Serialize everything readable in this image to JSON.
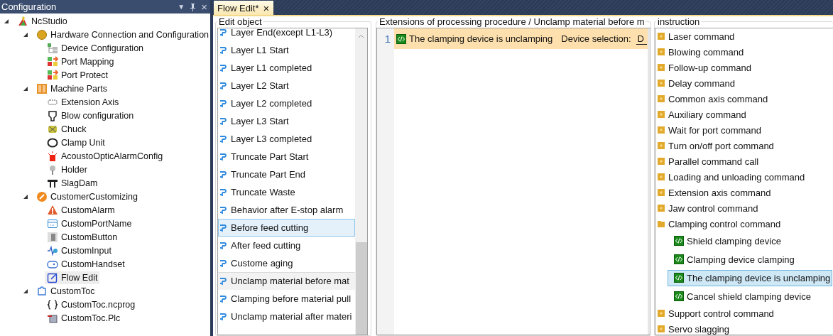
{
  "config_panel": {
    "title": "Configuration",
    "menu_glyph": "▼",
    "close_glyph": "×",
    "tree": [
      {
        "label": "NcStudio",
        "expanded": true,
        "selected": false,
        "children": [
          {
            "label": "Hardware Connection and Configuration",
            "expanded": true,
            "selected": false,
            "children": [
              {
                "label": "Device Configuration",
                "selected": false
              },
              {
                "label": "Port Mapping",
                "selected": false
              },
              {
                "label": "Port Protect",
                "selected": false
              }
            ]
          },
          {
            "label": "Machine Parts",
            "expanded": true,
            "selected": false,
            "children": [
              {
                "label": "Extension Axis",
                "selected": false
              },
              {
                "label": "Blow configuration",
                "selected": false
              },
              {
                "label": "Chuck",
                "selected": false
              },
              {
                "label": "Clamp Unit",
                "selected": false
              },
              {
                "label": "AcoustoOpticAlarmConfig",
                "selected": false
              },
              {
                "label": "Holder",
                "selected": false
              },
              {
                "label": "SlagDam",
                "selected": false
              }
            ]
          },
          {
            "label": "CustomerCustomizing",
            "expanded": true,
            "selected": false,
            "children": [
              {
                "label": "CustomAlarm",
                "selected": false
              },
              {
                "label": "CustomPortName",
                "selected": false
              },
              {
                "label": "CustomButton",
                "selected": false
              },
              {
                "label": "CustomInput",
                "selected": false
              },
              {
                "label": "CustomHandset",
                "selected": false
              },
              {
                "label": "Flow Edit",
                "selected": true
              }
            ]
          },
          {
            "label": "CustomToc",
            "expanded": true,
            "selected": false,
            "children": [
              {
                "label": "CustomToc.ncprog",
                "selected": false
              },
              {
                "label": "CustomToc.Plc",
                "selected": false
              }
            ]
          }
        ]
      }
    ]
  },
  "tabs": [
    {
      "label": "Flow Edit*",
      "selected": true,
      "close_glyph": "×"
    }
  ],
  "edit_object": {
    "title": "Edit object",
    "items": [
      {
        "label": "Layer End(except L1-L3)",
        "selected": false,
        "hovered": false
      },
      {
        "label": "Layer L1 Start",
        "selected": false,
        "hovered": false
      },
      {
        "label": "Layer L1 completed",
        "selected": false,
        "hovered": false
      },
      {
        "label": "Layer L2 Start",
        "selected": false,
        "hovered": false
      },
      {
        "label": "Layer L2 completed",
        "selected": false,
        "hovered": false
      },
      {
        "label": "Layer L3 Start",
        "selected": false,
        "hovered": false
      },
      {
        "label": "Layer L3 completed",
        "selected": false,
        "hovered": false
      },
      {
        "label": "Truncate Part Start",
        "selected": false,
        "hovered": false
      },
      {
        "label": "Truncate Part End",
        "selected": false,
        "hovered": false
      },
      {
        "label": "Truncate Waste",
        "selected": false,
        "hovered": false
      },
      {
        "label": "Behavior after E-stop alarm",
        "selected": false,
        "hovered": false
      },
      {
        "label": "Before feed cutting",
        "selected": true,
        "hovered": false
      },
      {
        "label": "After feed cutting",
        "selected": false,
        "hovered": false
      },
      {
        "label": "Custome aging",
        "selected": false,
        "hovered": false
      },
      {
        "label": "Unclamp material before mat",
        "selected": false,
        "hovered": true
      },
      {
        "label": "Clamping before material pull",
        "selected": false,
        "hovered": false
      },
      {
        "label": "Unclamp material after materi",
        "selected": false,
        "hovered": false
      }
    ]
  },
  "editor": {
    "title": "Extensions of processing procedure / Unclamp material before m",
    "lines": [
      {
        "number": "1",
        "selected": true,
        "command": "The clamping device is unclamping",
        "param_label": "Device selection:",
        "param_value": "D"
      }
    ]
  },
  "instruction": {
    "title": "instruction",
    "items": [
      {
        "label": "Laser command",
        "expanded": false
      },
      {
        "label": "Blowing command",
        "expanded": false
      },
      {
        "label": "Follow-up command",
        "expanded": false
      },
      {
        "label": "Delay command",
        "expanded": false
      },
      {
        "label": "Common axis command",
        "expanded": false
      },
      {
        "label": "Auxiliary command",
        "expanded": false
      },
      {
        "label": "Wait for port command",
        "expanded": false
      },
      {
        "label": "Turn on/off port command",
        "expanded": false
      },
      {
        "label": "Parallel command call",
        "expanded": false
      },
      {
        "label": "Loading and unloading command",
        "expanded": false
      },
      {
        "label": "Extension axis command",
        "expanded": false
      },
      {
        "label": "Jaw control command",
        "expanded": false
      },
      {
        "label": "Clamping control command",
        "expanded": true,
        "children": [
          {
            "label": "Shield clamping device",
            "selected": false
          },
          {
            "label": "Clamping device clamping",
            "selected": false
          },
          {
            "label": "The clamping device is unclamping",
            "selected": true
          },
          {
            "label": "Cancel shield clamping device",
            "selected": false
          }
        ]
      },
      {
        "label": "Support control command",
        "expanded": false
      },
      {
        "label": "Servo slagging",
        "expanded": false
      }
    ]
  }
}
